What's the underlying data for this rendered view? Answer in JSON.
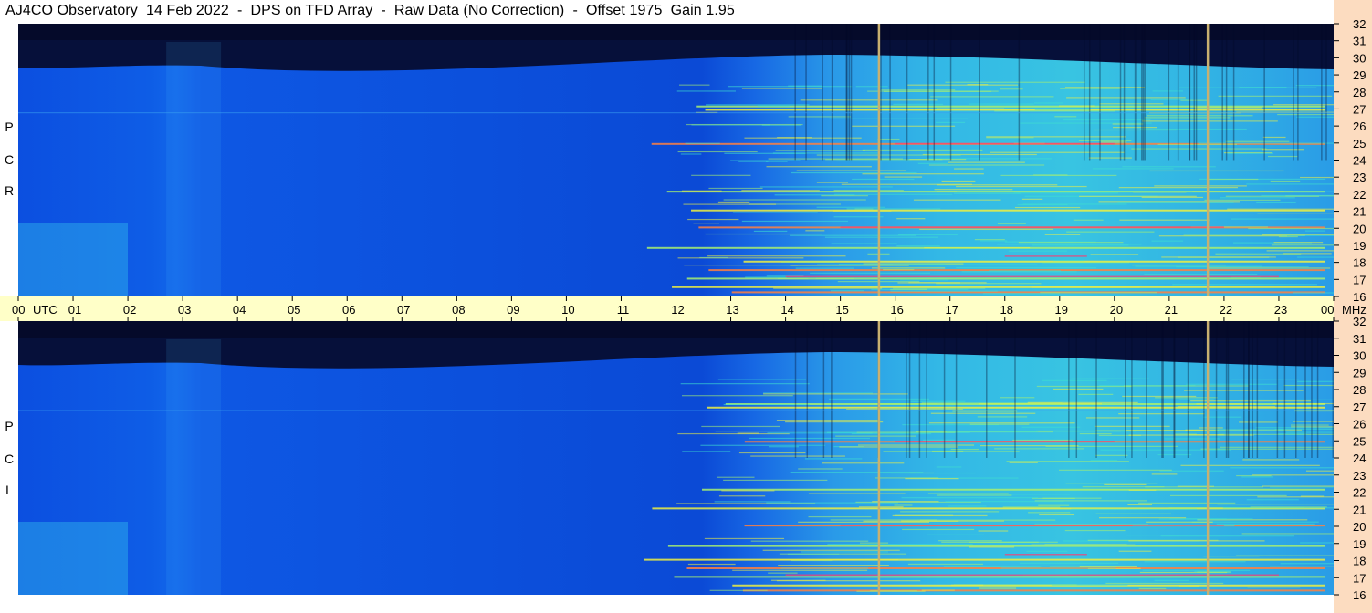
{
  "header": {
    "title": "AJ4CO Observatory  14 Feb 2022  -  DPS on TFD Array  -  Raw Data (No Correction)  -  Offset 1975  Gain 1.95"
  },
  "panels": {
    "top_label": [
      "R",
      "C",
      "P"
    ],
    "bottom_label": [
      "L",
      "C",
      "P"
    ]
  },
  "chart_data": {
    "type": "heatmap",
    "title": "AJ4CO Observatory  14 Feb 2022  -  DPS on TFD Array  -  Raw Data (No Correction)  -  Offset 1975  Gain 1.95",
    "x_axis": {
      "unit_label": "UTC",
      "range_hours": [
        0,
        24
      ],
      "tick_labels": [
        "00",
        "01",
        "02",
        "03",
        "04",
        "05",
        "06",
        "07",
        "08",
        "09",
        "10",
        "11",
        "12",
        "13",
        "14",
        "15",
        "16",
        "17",
        "18",
        "19",
        "20",
        "21",
        "22",
        "23",
        "00"
      ]
    },
    "y_axis": {
      "unit_label": "MHz",
      "range_mhz": [
        16,
        32
      ],
      "tick_labels": [
        "32",
        "31",
        "30",
        "29",
        "28",
        "27",
        "26",
        "25",
        "24",
        "23",
        "22",
        "21",
        "20",
        "19",
        "18",
        "17",
        "16"
      ]
    },
    "panels": [
      "RCP",
      "LCP"
    ],
    "colormap": [
      "#05082a",
      "#0020b0",
      "#0a55e8",
      "#1aa8f0",
      "#40e0d0",
      "#a8f070",
      "#f0f040",
      "#ff8040",
      "#ff3060"
    ],
    "markers_utc": [
      15.7,
      21.7
    ],
    "marker_color": "#c8b070",
    "grid": false
  }
}
